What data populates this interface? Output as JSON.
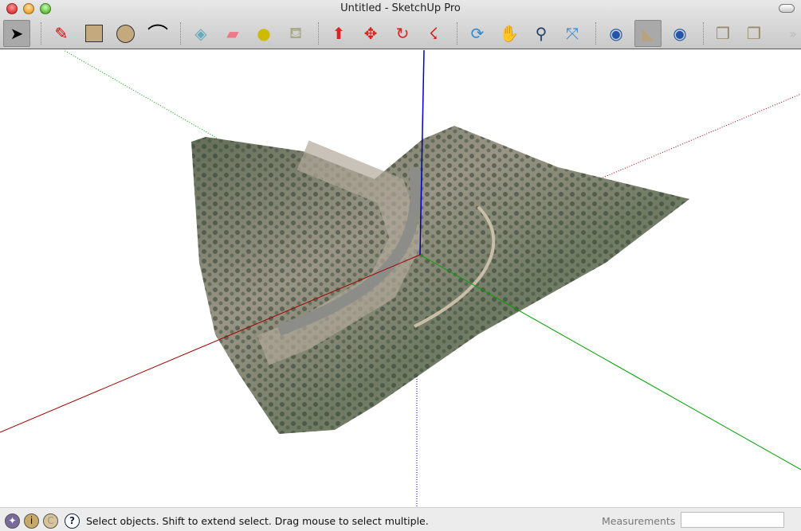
{
  "window": {
    "title": "Untitled - SketchUp Pro"
  },
  "toolbar": {
    "tools": [
      {
        "name": "select",
        "icon": "arrow-cursor-icon",
        "selected": true
      },
      {
        "name": "pencil",
        "icon": "pencil-icon"
      },
      {
        "name": "rectangle",
        "icon": "rectangle-icon"
      },
      {
        "name": "circle",
        "icon": "circle-icon"
      },
      {
        "name": "arc",
        "icon": "arc-icon"
      },
      {
        "name": "make-component",
        "icon": "component-icon"
      },
      {
        "name": "eraser",
        "icon": "eraser-icon"
      },
      {
        "name": "tape-measure",
        "icon": "tape-measure-icon"
      },
      {
        "name": "paint-bucket",
        "icon": "paint-bucket-icon"
      },
      {
        "name": "push-pull",
        "icon": "push-pull-icon"
      },
      {
        "name": "move",
        "icon": "move-icon"
      },
      {
        "name": "rotate",
        "icon": "rotate-icon"
      },
      {
        "name": "follow-me",
        "icon": "follow-me-icon"
      },
      {
        "name": "orbit",
        "icon": "orbit-icon"
      },
      {
        "name": "pan",
        "icon": "hand-icon"
      },
      {
        "name": "zoom",
        "icon": "zoom-icon"
      },
      {
        "name": "zoom-extents",
        "icon": "zoom-extents-icon"
      },
      {
        "name": "get-current-view",
        "icon": "earth-download-icon"
      },
      {
        "name": "toggle-terrain",
        "icon": "terrain-icon",
        "selected": true
      },
      {
        "name": "place-model",
        "icon": "earth-upload-icon"
      },
      {
        "name": "get-models",
        "icon": "warehouse-download-icon"
      },
      {
        "name": "share-model",
        "icon": "warehouse-upload-icon"
      }
    ]
  },
  "status": {
    "hint": "Select objects. Shift to extend select. Drag mouse to select multiple.",
    "measurements_label": "Measurements",
    "measurements_value": ""
  },
  "colors": {
    "axis_red": "#a00000",
    "axis_green": "#00a000",
    "axis_blue": "#0000c0"
  }
}
